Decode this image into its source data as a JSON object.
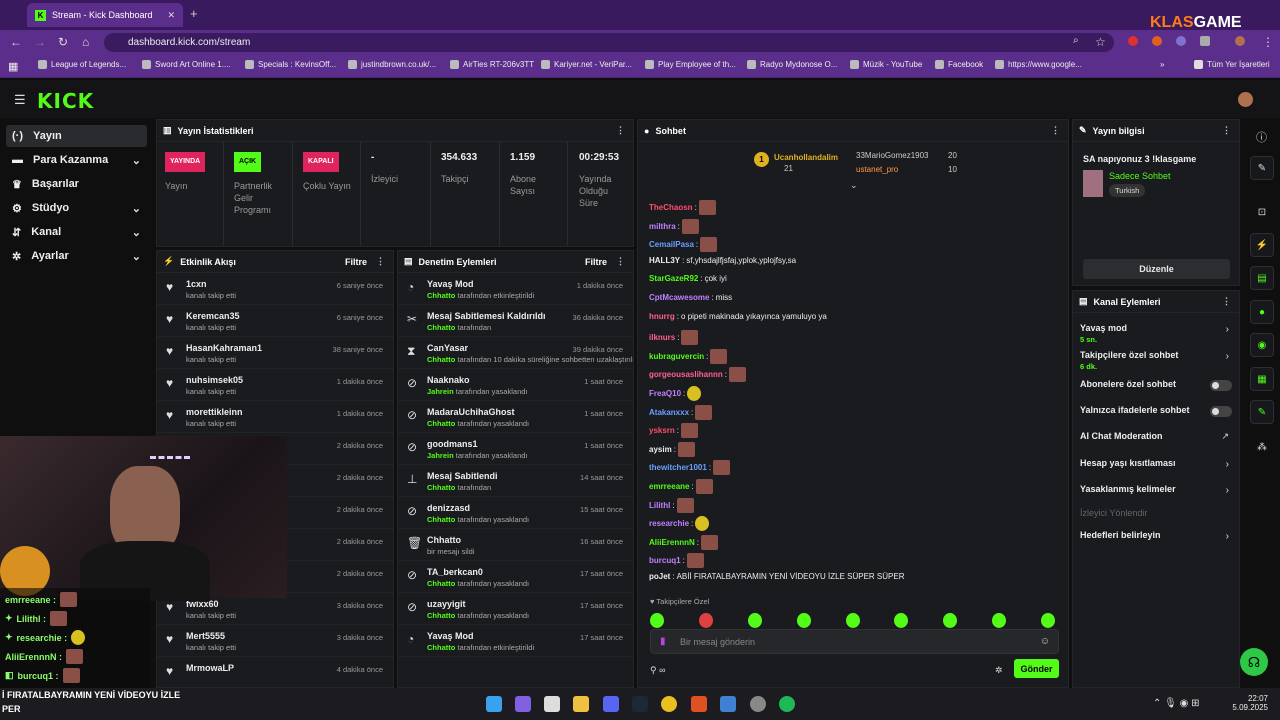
{
  "browser": {
    "tab_title": "Stream - Kick Dashboard",
    "url": "dashboard.kick.com/stream",
    "overlay_brand_left": "KLAS",
    "overlay_brand_right": "GAME",
    "bookmarks": [
      "League of Legends...",
      "Sword Art Online 1....",
      "Specials : KevinsOff...",
      "justindbrown.co.uk/...",
      "AirTies RT-206v3TT",
      "Kariyer.net - VeriPar...",
      "Play Employee of th...",
      "Radyo Mydonose O...",
      "Müzik - YouTube",
      "Facebook",
      "https://www.google..."
    ],
    "bookmarks_all": "Tüm Yer İşaretleri"
  },
  "kick": {
    "logo": "KICK"
  },
  "sidebar": {
    "items": [
      {
        "label": "Yayın",
        "icon": "broadcast-icon"
      },
      {
        "label": "Para Kazanma",
        "icon": "money-icon"
      },
      {
        "label": "Başarılar",
        "icon": "trophy-icon"
      },
      {
        "label": "Stüdyo",
        "icon": "studio-icon"
      },
      {
        "label": "Kanal",
        "icon": "channel-icon"
      },
      {
        "label": "Ayarlar",
        "icon": "gear-icon"
      }
    ]
  },
  "stats": {
    "title": "Yayın İstatistikleri",
    "items": [
      {
        "badge": "YAYINDA",
        "badge_color": "#e0245e",
        "label": "Yayın"
      },
      {
        "badge": "AÇIK",
        "badge_color": "#53fc18",
        "label": "Partnerlik Gelir Programı"
      },
      {
        "badge": "KAPALI",
        "badge_color": "#e0245e",
        "label": "Çoklu Yayın"
      },
      {
        "value": "-",
        "label": "İzleyici"
      },
      {
        "value": "354.633",
        "label": "Takipçi"
      },
      {
        "value": "1.159",
        "label": "Abone Sayısı"
      },
      {
        "value": "00:29:53",
        "label": "Yayında Olduğu Süre"
      }
    ]
  },
  "activity": {
    "title": "Etkinlik Akışı",
    "filter": "Filtre",
    "rows": [
      {
        "name": "1cxn",
        "sub": "kanalı takip etti",
        "time": "6 saniye önce"
      },
      {
        "name": "Keremcan35",
        "sub": "kanalı takip etti",
        "time": "6 saniye önce"
      },
      {
        "name": "HasanKahraman1",
        "sub": "kanalı takip etti",
        "time": "38 saniye önce"
      },
      {
        "name": "nuhsimsek05",
        "sub": "kanalı takip etti",
        "time": "1 dakika önce"
      },
      {
        "name": "morettikleinn",
        "sub": "kanalı takip etti",
        "time": "1 dakika önce"
      },
      {
        "name": "",
        "sub": "",
        "time": "2 dakika önce"
      },
      {
        "name": "",
        "sub": "",
        "time": "2 dakika önce"
      },
      {
        "name": "",
        "sub": "",
        "time": "2 dakika önce"
      },
      {
        "name": "",
        "sub": "",
        "time": "2 dakika önce"
      },
      {
        "name": "",
        "sub": "",
        "time": "2 dakika önce"
      },
      {
        "name": "fwixx60",
        "sub": "kanalı takip etti",
        "time": "3 dakika önce"
      },
      {
        "name": "Mert5555",
        "sub": "kanalı takip etti",
        "time": "3 dakika önce"
      },
      {
        "name": "MrmowaLP",
        "sub": "",
        "time": "4 dakika önce"
      }
    ]
  },
  "moderation": {
    "title": "Denetim Eylemleri",
    "filter": "Filtre",
    "rows": [
      {
        "icon": "speedometer-icon",
        "name": "Yavaş Mod",
        "actor": "Chhatto",
        "sub": "tarafından etkinleştirildi",
        "time": "1 dakika önce"
      },
      {
        "icon": "unpin-icon",
        "name": "Mesaj Sabitlemesi Kaldırıldı",
        "actor": "Chhatto",
        "sub": "tarafından",
        "time": "36 dakika önce"
      },
      {
        "icon": "hourglass-icon",
        "name": "CanYasar",
        "actor": "Chhatto",
        "sub": "tarafından 10 dakika süreliğine sohbetten uzaklaştırıldı",
        "time": "39 dakika önce"
      },
      {
        "icon": "ban-icon",
        "name": "Naaknako",
        "actor": "Jahrein",
        "sub": "tarafından yasaklandı",
        "time": "1 saat önce"
      },
      {
        "icon": "ban-icon",
        "name": "MadaraUchihaGhost",
        "actor": "Chhatto",
        "sub": "tarafından yasaklandı",
        "time": "1 saat önce"
      },
      {
        "icon": "ban-icon",
        "name": "goodmans1",
        "actor": "Jahrein",
        "sub": "tarafından yasaklandı",
        "time": "1 saat önce"
      },
      {
        "icon": "pin-icon",
        "name": "Mesaj Sabitlendi",
        "actor": "Chhatto",
        "sub": "tarafından",
        "time": "14 saat önce"
      },
      {
        "icon": "ban-icon",
        "name": "denizzasd",
        "actor": "Chhatto",
        "sub": "tarafından yasaklandı",
        "time": "15 saat önce"
      },
      {
        "icon": "trash-icon",
        "name": "Chhatto",
        "actor": "",
        "sub": "bir mesajı sildi",
        "time": "16 saat önce"
      },
      {
        "icon": "ban-icon",
        "name": "TA_berkcan0",
        "actor": "Chhatto",
        "sub": "tarafından yasaklandı",
        "time": "17 saat önce"
      },
      {
        "icon": "ban-icon",
        "name": "uzayyigit",
        "actor": "Chhatto",
        "sub": "tarafından yasaklandı",
        "time": "17 saat önce"
      },
      {
        "icon": "speedometer-icon",
        "name": "Yavaş Mod",
        "actor": "Chhatto",
        "sub": "tarafından etkinleştirildi",
        "time": "17 saat önce"
      }
    ]
  },
  "chat": {
    "title": "Sohbet",
    "leaders": [
      {
        "rank": "1",
        "name": "Ucanhollandalim",
        "count": "21"
      },
      {
        "name": "33MarioGomez1903",
        "count": "20"
      },
      {
        "name": "ustanet_pro",
        "count": "10"
      }
    ],
    "messages": [
      {
        "user": "TheChaosn",
        "color": "#ff4d6d",
        "text": "",
        "emote": "e"
      },
      {
        "user": "milthra",
        "color": "#c080ff",
        "text": "",
        "emote": "e"
      },
      {
        "user": "CemailPasa",
        "color": "#6aa0ff",
        "text": "",
        "emote": "e"
      },
      {
        "user": "HALL3Y",
        "color": "#eee",
        "text": "sf,yhsdajlfjsfaj,yplok,yplojfsy,sa",
        "emote": ""
      },
      {
        "user": "StarGazeR92",
        "color": "#53fc18",
        "text": "çok iyi",
        "emote": ""
      },
      {
        "user": "CptMcawesome",
        "color": "#c080ff",
        "text": "miss",
        "emote": ""
      },
      {
        "user": "hnurrg",
        "color": "#ff6090",
        "text": "o pipeti makinada yıkayınca yamuluyo ya",
        "emote": ""
      },
      {
        "user": "ilknurs",
        "color": "#ff6090",
        "text": "",
        "emote": "e"
      },
      {
        "user": "kubraguvercin",
        "color": "#53fc18",
        "text": "",
        "emote": "e"
      },
      {
        "user": "gorgeousaslihannn",
        "color": "#ff6090",
        "text": "",
        "emote": "e"
      },
      {
        "user": "FreaQ10",
        "color": "#c080ff",
        "text": "",
        "emote": "y"
      },
      {
        "user": "Atakanxxx",
        "color": "#6aa0ff",
        "text": "",
        "emote": "e"
      },
      {
        "user": "ysksrn",
        "color": "#ff4d6d",
        "text": "",
        "emote": "e"
      },
      {
        "user": "aysim",
        "color": "#eee",
        "text": "",
        "emote": "e"
      },
      {
        "user": "thewitcher1001",
        "color": "#6aa0ff",
        "text": "",
        "emote": "e"
      },
      {
        "user": "emrreeane",
        "color": "#53fc18",
        "text": "",
        "emote": "e"
      },
      {
        "user": "Lilithl",
        "color": "#c080ff",
        "text": "",
        "emote": "e"
      },
      {
        "user": "researchie",
        "color": "#c080ff",
        "text": "",
        "emote": "y"
      },
      {
        "user": "AliiErennnN",
        "color": "#53fc18",
        "text": "",
        "emote": "e"
      },
      {
        "user": "burcuq1",
        "color": "#c080ff",
        "text": "",
        "emote": "e"
      },
      {
        "user": "poJet",
        "color": "#eee",
        "text": "ABİİ FIRATALBAYRAMIN YENİ VİDEOYU İZLE SÜPER SÜPER",
        "emote": ""
      }
    ],
    "followers_only": "Takipçilere Özel",
    "input_placeholder": "Bir mesaj gönderin",
    "send": "Gönder"
  },
  "stream_info": {
    "title": "Yayın bilgisi",
    "stream_title": "SA napıyonuz 3 !klasgame",
    "category": "Sadece Sohbet",
    "tag": "Turkish",
    "edit": "Düzenle"
  },
  "channel_actions": {
    "title": "Kanal Eylemleri",
    "items": [
      {
        "label": "Yavaş mod",
        "sub": "5 sn.",
        "kind": "chev"
      },
      {
        "label": "Takipçilere özel sohbet",
        "sub": "6 dk.",
        "kind": "chev"
      },
      {
        "label": "Abonelere özel sohbet",
        "sub": "",
        "kind": "toggle"
      },
      {
        "label": "Yalnızca ifadelerle sohbet",
        "sub": "",
        "kind": "toggle"
      },
      {
        "label": "AI Chat Moderation",
        "sub": "",
        "kind": "external"
      },
      {
        "label": "Hesap yaşı kısıtlaması",
        "sub": "",
        "kind": "chev"
      },
      {
        "label": "Yasaklanmış kelimeler",
        "sub": "",
        "kind": "chev"
      },
      {
        "label": "İzleyici Yönlendir",
        "sub": "",
        "kind": "disabled"
      },
      {
        "label": "Hedefleri belirleyin",
        "sub": "",
        "kind": "chev"
      }
    ]
  },
  "overlay": {
    "lines": [
      {
        "user": "emrreeane :",
        "color": "#53fc18"
      },
      {
        "user": "Lilithl :",
        "color": "#53fc18"
      },
      {
        "user": "researchie :",
        "color": "#53fc18"
      },
      {
        "user": "AliiErennnN :",
        "color": "#53fc18"
      },
      {
        "user": "burcuq1 :",
        "color": "#53fc18"
      }
    ],
    "ticker1": "İ FIRATALBAYRAMIN YENİ VİDEOYU İZLE",
    "ticker2": "PER"
  },
  "taskbar": {
    "time": "22:07",
    "date": "5.09.2025"
  }
}
